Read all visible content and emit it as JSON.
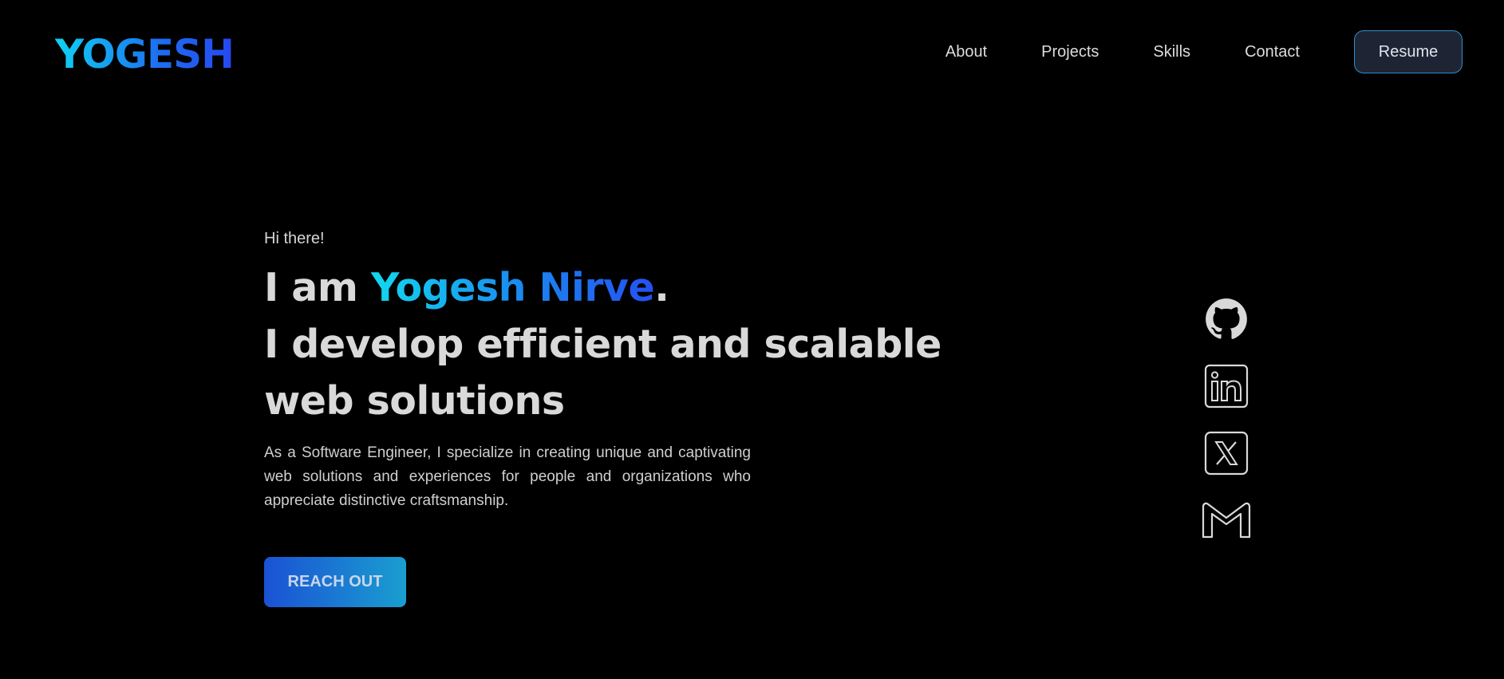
{
  "header": {
    "logo": "YOGESH",
    "nav": [
      "About",
      "Projects",
      "Skills",
      "Contact"
    ],
    "resume_label": "Resume"
  },
  "hero": {
    "greeting": "Hi there!",
    "intro_prefix": "I am ",
    "name": "Yogesh Nirve",
    "intro_suffix": ".",
    "tagline_line1": "I develop efficient and scalable",
    "tagline_line2": "web solutions",
    "bio": "As a Software Engineer, I specialize in creating unique and captivating web solutions and experiences for people and organizations who appreciate distinctive craftsmanship.",
    "cta_label": "REACH OUT"
  },
  "social": {
    "icons": [
      "github-icon",
      "linkedin-icon",
      "x-icon",
      "gmail-icon"
    ]
  },
  "colors": {
    "background": "#000000",
    "gradient_start": "#12d8ee",
    "gradient_end": "#2450f2",
    "text": "#d9d9d9"
  }
}
